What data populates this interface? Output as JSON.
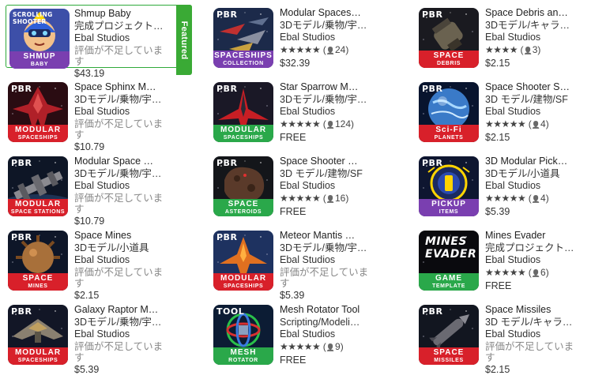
{
  "featured_label": "Featured",
  "products": [
    {
      "col": 0,
      "row": 0,
      "featured": true,
      "title": "Shmup Baby",
      "category": "完成プロジェクト…",
      "developer": "Ebal Studios",
      "rating_text": "評価が不足していま",
      "rating_text2": "す",
      "price": "$43.19",
      "badge_top": "SCROLLING SHOOTER",
      "band1": "SHMUP",
      "band2": "BABY",
      "band_color": "#7a3fb0",
      "bg": "#3a3a8a",
      "icon": "baby-icon"
    },
    {
      "col": 1,
      "row": 0,
      "title": "Modular Spaces…",
      "category": "3Dモデル/乗物/宇…",
      "developer": "Ebal Studios",
      "stars": "★★★★★",
      "count": "24",
      "price": "$32.39",
      "badge_top": "PBR",
      "band1": "SPACESHIPS",
      "band2": "COLLECTION",
      "band_color": "#7a3fb0",
      "bg": "#1a2244",
      "icon": "ships-icon"
    },
    {
      "col": 2,
      "row": 0,
      "title": "Space Debris an…",
      "category": "3Dモデル/キャラ…",
      "developer": "Ebal Studios",
      "stars": "★★★★",
      "count": "3",
      "price": "$2.15",
      "badge_top": "PBR",
      "band1": "SPACE",
      "band2": "DEBRIS",
      "band_color": "#d8202a",
      "bg": "#1a1a22",
      "icon": "debris-icon"
    },
    {
      "col": 0,
      "row": 1,
      "title": "Space Sphinx M…",
      "category": "3Dモデル/乗物/宇…",
      "developer": "Ebal Studios",
      "rating_text": "評価が不足していま",
      "rating_text2": "す",
      "price": "$10.79",
      "badge_top": "PBR",
      "band1": "MODULAR",
      "band2": "SPACESHIPS",
      "band_color": "#d8202a",
      "bg": "#2a0f14",
      "icon": "sphinx-icon"
    },
    {
      "col": 1,
      "row": 1,
      "title": "Star Sparrow M…",
      "category": "3Dモデル/乗物/宇…",
      "developer": "Ebal Studios",
      "stars": "★★★★★",
      "count": "124",
      "price": "FREE",
      "badge_top": "PBR",
      "band1": "MODULAR",
      "band2": "SPACESHIPS",
      "band_color": "#2aa84a",
      "bg": "#1a1622",
      "icon": "sparrow-icon"
    },
    {
      "col": 2,
      "row": 1,
      "title": "Space Shooter S…",
      "category": "3D モデル/建物/SF",
      "developer": "Ebal Studios",
      "stars": "★★★★★",
      "count": "4",
      "price": "$2.15",
      "badge_top": "PBR",
      "band1": "Sci-Fi",
      "band2": "PLANETS",
      "band_color": "#d8202a",
      "bg": "#0c1c3a",
      "icon": "planet-icon"
    },
    {
      "col": 0,
      "row": 2,
      "title": "Modular Space …",
      "category": "3Dモデル/乗物/宇…",
      "developer": "Ebal Studios",
      "rating_text": "評価が不足していま",
      "rating_text2": "す",
      "price": "$10.79",
      "badge_top": "PBR",
      "band1": "MODULAR",
      "band2": "SPACE STATIONS",
      "band_color": "#d8202a",
      "bg": "#101828",
      "icon": "station-icon"
    },
    {
      "col": 1,
      "row": 2,
      "title": "Space Shooter …",
      "category": "3D モデル/建物/SF",
      "developer": "Ebal Studios",
      "stars": "★★★★★",
      "count": "16",
      "price": "FREE",
      "badge_top": "PBR",
      "band1": "SPACE",
      "band2": "ASTEROIDS",
      "band_color": "#2aa84a",
      "bg": "#121418",
      "icon": "asteroid-icon"
    },
    {
      "col": 2,
      "row": 2,
      "title": "3D Modular Pick…",
      "category": "3Dモデル/小道具",
      "developer": "Ebal Studios",
      "stars": "★★★★★",
      "count": "4",
      "price": "$5.39",
      "badge_top": "PBR",
      "band1": "PICKUP",
      "band2": "ITEMS",
      "band_color": "#7a3fb0",
      "bg": "#101830",
      "icon": "pickup-icon"
    },
    {
      "col": 0,
      "row": 3,
      "title": "Space Mines",
      "category": "3Dモデル/小道具",
      "developer": "Ebal Studios",
      "rating_text": "評価が不足していま",
      "rating_text2": "す",
      "price": "$2.15",
      "badge_top": "PBR",
      "band1": "SPACE",
      "band2": "MINES",
      "band_color": "#d8202a",
      "bg": "#10182a",
      "icon": "mine-icon"
    },
    {
      "col": 1,
      "row": 3,
      "title": "Meteor Mantis …",
      "category": "3Dモデル/乗物/宇…",
      "developer": "Ebal Studios",
      "rating_text": "評価が不足していま",
      "rating_text2": "す",
      "price": "$5.39",
      "badge_top": "PBR",
      "band1": "MODULAR",
      "band2": "SPACESHIPS",
      "band_color": "#d8202a",
      "bg": "#1a2a4a",
      "icon": "mantis-icon"
    },
    {
      "col": 2,
      "row": 3,
      "title": "Mines Evader",
      "category": "完成プロジェクト…",
      "developer": "Ebal Studios",
      "stars": "★★★★★",
      "count": "6",
      "price": "FREE",
      "badge_top": "",
      "band1": "GAME",
      "band2": "TEMPLATE",
      "band_color": "#2aa84a",
      "bg": "#0c0c10",
      "icon": "mines-evader-logo-icon",
      "logo_text1": "MINES",
      "logo_text2": "EVADER"
    },
    {
      "col": 0,
      "row": 4,
      "title": "Galaxy Raptor M…",
      "category": "3Dモデル/乗物/宇…",
      "developer": "Ebal Studios",
      "rating_text": "評価が不足していま",
      "rating_text2": "す",
      "price": "$5.39",
      "badge_top": "PBR",
      "band1": "MODULAR",
      "band2": "SPACESHIPS",
      "band_color": "#d8202a",
      "bg": "#141828",
      "icon": "raptor-icon"
    },
    {
      "col": 1,
      "row": 4,
      "title": "Mesh Rotator Tool",
      "category": "Scripting/Modeli…",
      "developer": "Ebal Studios",
      "stars": "★★★★★",
      "count": "9",
      "price": "FREE",
      "badge_top": "TOOL",
      "band1": "MESH",
      "band2": "ROTATOR",
      "band_color": "#2aa84a",
      "bg": "#0e2038",
      "icon": "gizmo-icon"
    },
    {
      "col": 2,
      "row": 4,
      "title": "Space Missiles",
      "category": "3D モデル/キャラ…",
      "developer": "Ebal Studios",
      "rating_text": "評価が不足していま",
      "rating_text2": "す",
      "price": "$2.15",
      "badge_top": "PBR",
      "band1": "SPACE",
      "band2": "MISSILES",
      "band_color": "#d8202a",
      "bg": "#141822",
      "icon": "missile-icon"
    }
  ]
}
